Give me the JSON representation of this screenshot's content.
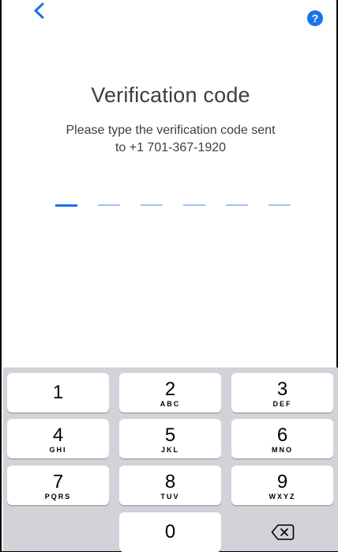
{
  "header": {
    "help_glyph": "?",
    "accent_color": "#1a73e8"
  },
  "main": {
    "title": "Verification code",
    "subtitle_line1": "Please type the verification code sent",
    "subtitle_line2": "to +1 701-367-1920",
    "code_length": 6,
    "active_slot": 1
  },
  "keypad": {
    "keys": [
      {
        "digit": "1",
        "letters": ""
      },
      {
        "digit": "2",
        "letters": "ABC"
      },
      {
        "digit": "3",
        "letters": "DEF"
      },
      {
        "digit": "4",
        "letters": "GHI"
      },
      {
        "digit": "5",
        "letters": "JKL"
      },
      {
        "digit": "6",
        "letters": "MNO"
      },
      {
        "digit": "7",
        "letters": "PQRS"
      },
      {
        "digit": "8",
        "letters": "TUV"
      },
      {
        "digit": "9",
        "letters": "WXYZ"
      },
      {
        "digit": "0",
        "letters": ""
      }
    ],
    "backspace_icon": "backspace-icon"
  }
}
